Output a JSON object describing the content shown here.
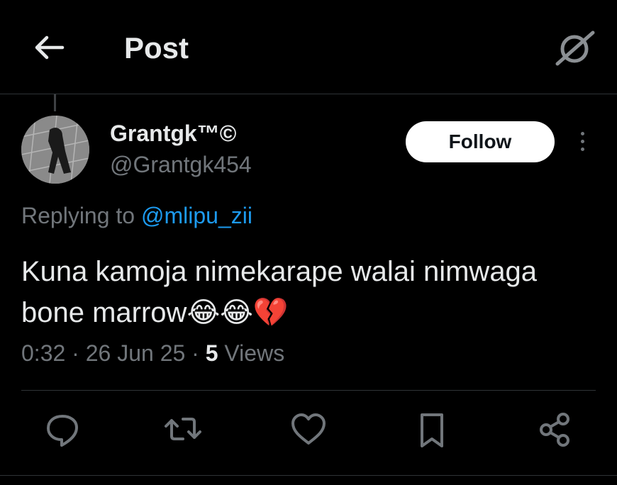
{
  "header": {
    "title": "Post"
  },
  "author": {
    "name": "Grantgk™©",
    "handle": "@Grantgk454"
  },
  "follow_label": "Follow",
  "reply": {
    "prefix": "Replying to ",
    "to": "@mlipu_zii"
  },
  "tweet": {
    "text": "Kuna kamoja nimekarape walai nimwaga bone marrow",
    "emojis": "😂😂💔"
  },
  "meta": {
    "time_date": "0:32 · 26 Jun 25 · ",
    "views_count": "5",
    "views_label": " Views"
  },
  "colors": {
    "accent": "#1d9bf0",
    "text": "#e7e9ea",
    "muted": "#71767b",
    "background": "#000000"
  }
}
